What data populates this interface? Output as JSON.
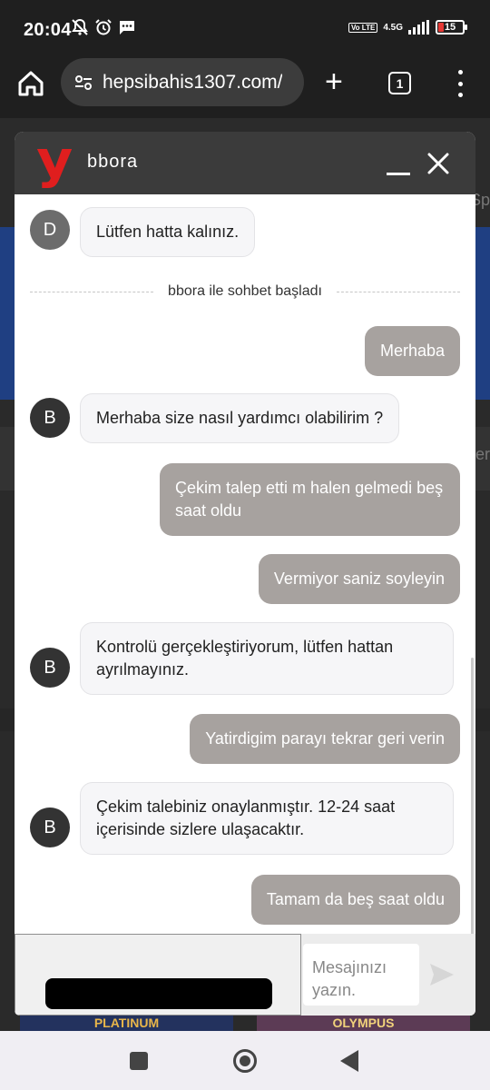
{
  "status_bar": {
    "time": "20:04",
    "network": "4.5G",
    "volte": "Vo LTE",
    "battery": "15",
    "battery_color": "#e53935"
  },
  "browser": {
    "url": "hepsibahis1307.com/",
    "tab_count": "1",
    "icons": [
      "home-icon",
      "site-settings-icon",
      "new-tab-icon",
      "tab-switcher-icon",
      "more-menu-icon"
    ]
  },
  "background_peeks": {
    "right_1": "Sp",
    "right_2": "er",
    "banner_left": "PLATINUM",
    "banner_right": "OLYMPUS"
  },
  "chat": {
    "agent_name": "bbora",
    "logo_letter": "y",
    "accent_color": "#e01e1e",
    "divider_text": "bbora ile sohbet başladı",
    "messages": [
      {
        "from": "agent",
        "avatar": "D",
        "text": "Lütfen hatta kalınız."
      },
      {
        "from": "user",
        "text": "Merhaba"
      },
      {
        "from": "agent",
        "avatar": "B",
        "text": "Merhaba size nasıl yardımcı olabilirim ?"
      },
      {
        "from": "user",
        "text": "Çekim talep etti m halen gelmedi beş saat oldu"
      },
      {
        "from": "user",
        "text": "Vermiyor saniz soyleyin"
      },
      {
        "from": "agent",
        "avatar": "B",
        "text": "Kontrolü gerçekleştiriyorum, lütfen hattan ayrılmayınız."
      },
      {
        "from": "user",
        "text": "Yatirdigim parayı tekrar geri verin"
      },
      {
        "from": "agent",
        "avatar": "B",
        "text": "Çekim talebiniz onaylanmıştır. 12-24 saat içerisinde sizlere ulaşacaktır."
      },
      {
        "from": "user",
        "text": "Tamam da beş saat oldu"
      }
    ],
    "input_placeholder": "Mesajınızı yazın.",
    "input_value": ""
  }
}
